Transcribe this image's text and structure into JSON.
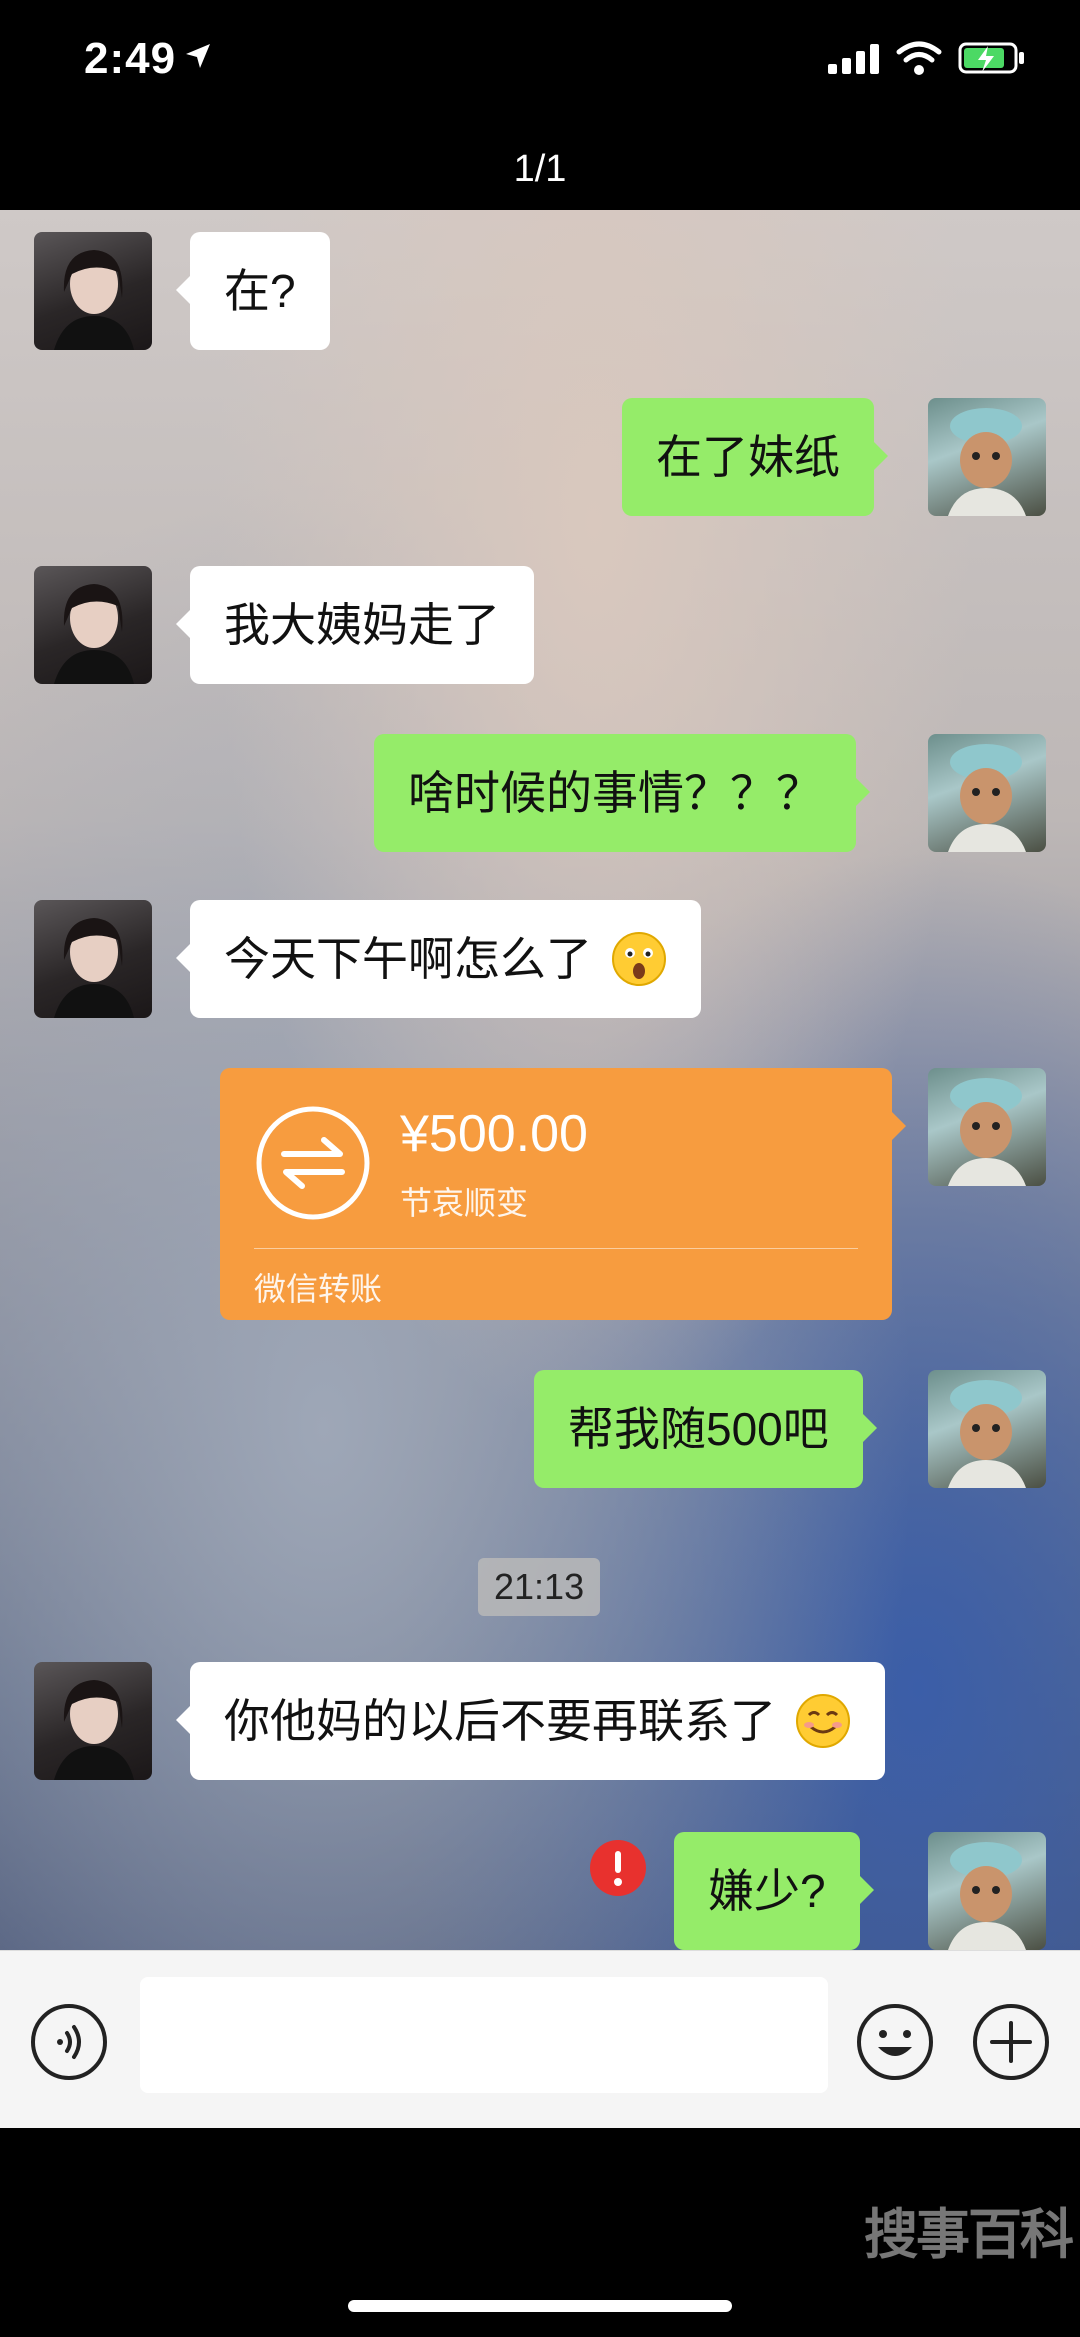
{
  "status_bar": {
    "time": "2:49"
  },
  "header": {
    "pager": "1/1"
  },
  "messages": [
    {
      "side": "in",
      "text": "在?"
    },
    {
      "side": "out",
      "text": "在了妹纸"
    },
    {
      "side": "in",
      "text": "我大姨妈走了"
    },
    {
      "side": "out",
      "text": "啥时候的事情？？？"
    },
    {
      "side": "in",
      "text": "今天下午啊怎么了"
    },
    {
      "side": "out",
      "text": "帮我随500吧"
    },
    {
      "side": "in",
      "text": "你他妈的以后不要再联系了"
    },
    {
      "side": "out",
      "text": "嫌少?"
    }
  ],
  "transfer": {
    "amount": "¥500.00",
    "note": "节哀顺变",
    "label": "微信转账"
  },
  "timestamp": "21:13",
  "input": {
    "value": ""
  },
  "watermark": "搜事百科",
  "colors": {
    "outgoing_bubble": "#95ec69",
    "incoming_bubble": "#ffffff",
    "transfer_card": "#f79c3f",
    "error_badge": "#e8312e"
  }
}
